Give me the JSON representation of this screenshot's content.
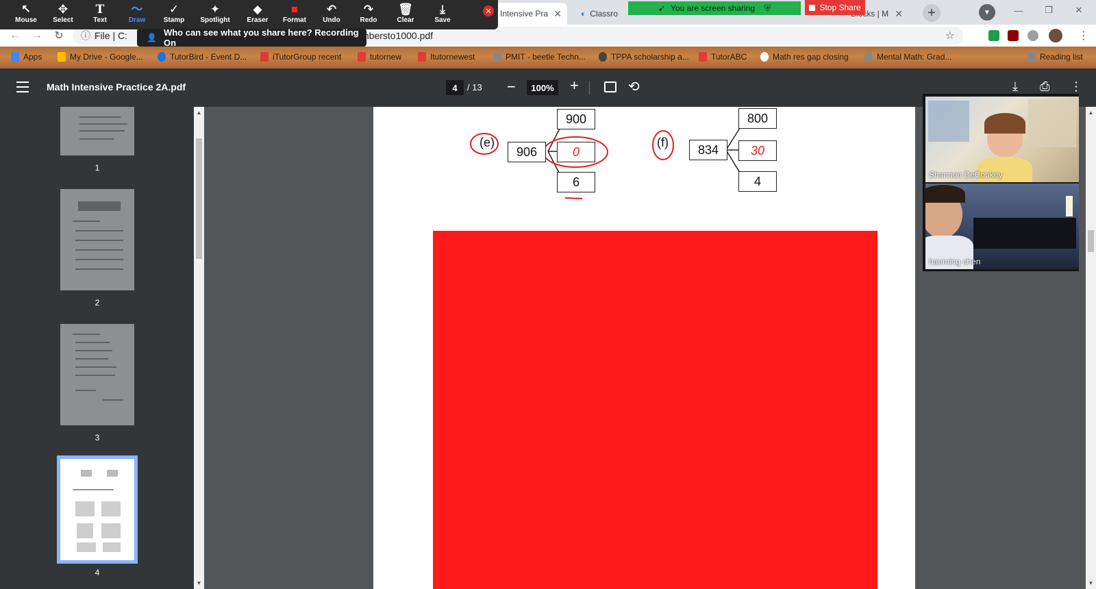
{
  "browser": {
    "tabs": [
      {
        "label": "ath Intensive Pra"
      },
      {
        "label": "Classro"
      },
      {
        "label": "Blocks | M"
      }
    ],
    "url": "File  |  C:",
    "url_tail": "mbersto1000.pdf",
    "new_tab_symbol": "+",
    "window_controls": [
      "—",
      "❐",
      "✕"
    ]
  },
  "bookmarks": [
    {
      "label": "Apps",
      "icon": "apps-grid-icon",
      "color": "#4285f4"
    },
    {
      "label": "My Drive - Google...",
      "icon": "google-drive-icon",
      "color": "#fbbc04"
    },
    {
      "label": "TutorBird - Event D...",
      "icon": "tutorbird-icon",
      "color": "#1a73e8"
    },
    {
      "label": "iTutorGroup recent",
      "icon": "itutor-icon",
      "color": "#e53935"
    },
    {
      "label": "tutornew",
      "icon": "itutor-icon",
      "color": "#e53935"
    },
    {
      "label": "Itutornewest",
      "icon": "itutor-icon",
      "color": "#e53935"
    },
    {
      "label": "PMIT - beetle Techn...",
      "icon": "globe-icon",
      "color": "#888888"
    },
    {
      "label": "TPPA scholarship a...",
      "icon": "soccer-icon",
      "color": "#444444"
    },
    {
      "label": "TutorABC",
      "icon": "itutor-icon",
      "color": "#e53935"
    },
    {
      "label": "Math res gap closing",
      "icon": "globe-icon",
      "color": "#ffffff"
    },
    {
      "label": "Mental Math: Grad...",
      "icon": "globe-icon",
      "color": "#888888"
    },
    {
      "label": "Reading list",
      "icon": "reading-list-icon",
      "color": "#888888"
    }
  ],
  "zoom_toolbar": {
    "tools": [
      {
        "label": "Mouse",
        "icon": "↖"
      },
      {
        "label": "Select",
        "icon": "✥"
      },
      {
        "label": "Text",
        "icon": "T"
      },
      {
        "label": "Draw",
        "icon": "〜"
      },
      {
        "label": "Stamp",
        "icon": "✓"
      },
      {
        "label": "Spotlight",
        "icon": "✦"
      },
      {
        "label": "Eraser",
        "icon": "◆"
      },
      {
        "label": "Format",
        "icon": "■"
      },
      {
        "label": "Undo",
        "icon": "↶"
      },
      {
        "label": "Redo",
        "icon": "↷"
      },
      {
        "label": "Clear",
        "icon": "🗑"
      },
      {
        "label": "Save",
        "icon": "⤓"
      }
    ],
    "selected_tool": "Draw",
    "tooltip": "Who can see what you share here? Recording On",
    "sharing_banner": "You are screen sharing",
    "stop_share": "Stop Share"
  },
  "pdf": {
    "title": "Math Intensive Practice 2A.pdf",
    "current_page": "4",
    "total_pages": "/ 13",
    "zoom": "100%",
    "thumbnails": [
      {
        "label": "1",
        "current": false
      },
      {
        "label": "2",
        "current": false
      },
      {
        "label": "3",
        "current": false
      },
      {
        "label": "4",
        "current": true
      }
    ],
    "questions": [
      {
        "label": "(e)",
        "total": "906",
        "hundreds": "900",
        "tens": "0",
        "ones": "6"
      },
      {
        "label": "(f)",
        "total": "834",
        "hundreds": "800",
        "tens": "30",
        "ones": "4"
      }
    ],
    "cover_color": "#ff1a1a",
    "ink_color": "#e01e1e"
  },
  "participants": [
    {
      "name": "Shannon DeConkey"
    },
    {
      "name": "haoming   chen"
    }
  ]
}
